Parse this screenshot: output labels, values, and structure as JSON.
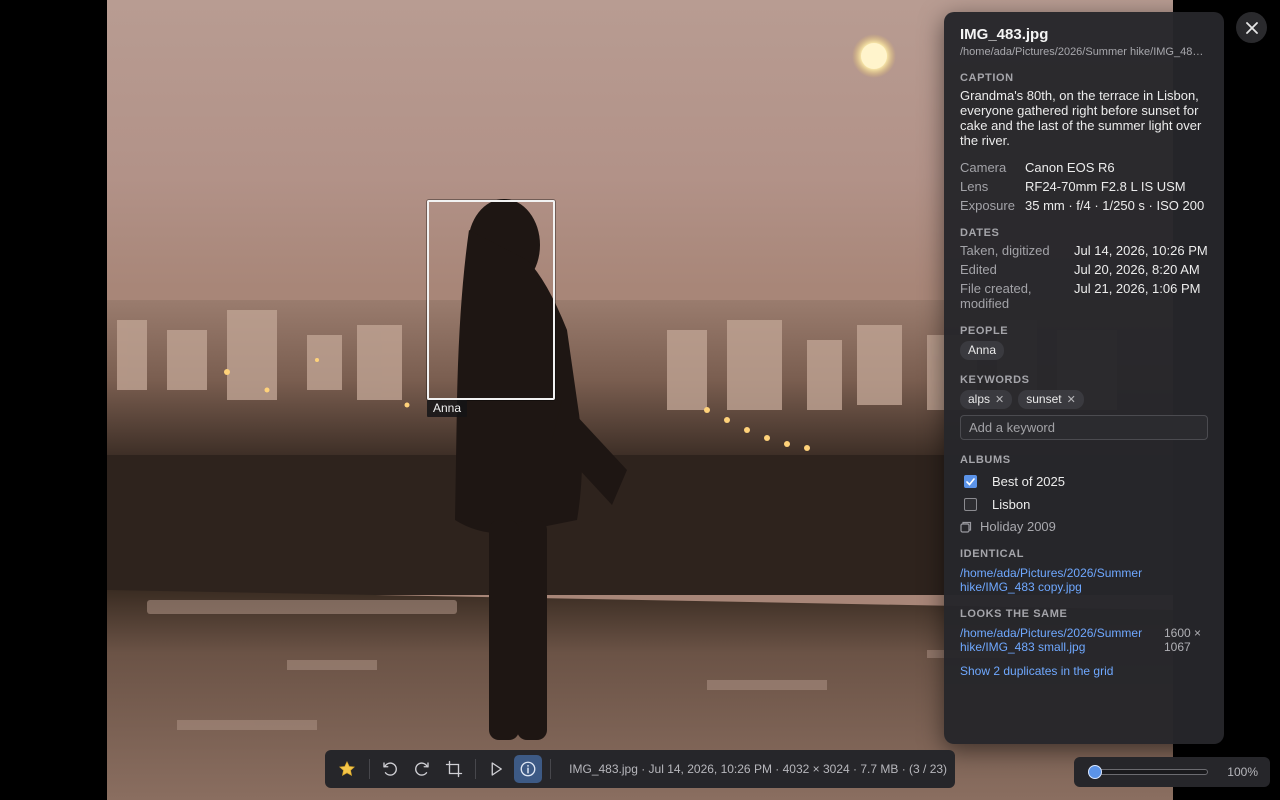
{
  "viewer": {
    "face": {
      "name": "Anna"
    }
  },
  "panel": {
    "file_name": "IMG_483.jpg",
    "file_path": "/home/ada/Pictures/2026/Summer hike/IMG_48…",
    "caption_label": "CAPTION",
    "caption": "Grandma's 80th, on the terrace in Lisbon, everyone gathered right before sunset for cake and the last of the summer light over the river.",
    "meta": [
      {
        "key": "Camera",
        "value": "Canon EOS R6",
        "link": true
      },
      {
        "key": "Lens",
        "value": "RF24-70mm F2.8 L IS USM",
        "link": true
      },
      {
        "key": "Exposure",
        "value": "35 mm · f/4 · 1/250 s · ISO 200",
        "link": false
      }
    ],
    "dates_label": "DATES",
    "dates": [
      {
        "key": "Taken, digitized",
        "value": "Jul 14, 2026, 10:26 PM"
      },
      {
        "key": "Edited",
        "value": "Jul 20, 2026, 8:20 AM"
      },
      {
        "key": "File created, modified",
        "value": "Jul 21, 2026, 1:06 PM"
      }
    ],
    "people_label": "PEOPLE",
    "people": [
      "Anna"
    ],
    "keywords_label": "KEYWORDS",
    "keywords": [
      "alps",
      "sunset"
    ],
    "keyword_placeholder": "Add a keyword",
    "albums_label": "ALBUMS",
    "albums": [
      {
        "name": "Best of 2025",
        "checked": true
      },
      {
        "name": "Lisbon",
        "checked": false
      }
    ],
    "smart_album": "Holiday 2009",
    "identical_label": "IDENTICAL",
    "identical_path": "/home/ada/Pictures/2026/Summer hike/IMG_483 copy.jpg",
    "similar_label": "LOOKS THE SAME",
    "similar_path": "/home/ada/Pictures/2026/Summer hike/IMG_483 small.jpg",
    "similar_size": "1600 × 1067",
    "show_duplicates": "Show 2 duplicates in the grid"
  },
  "toolbar": {
    "info": "IMG_483.jpg · Jul 14, 2026, 10:26 PM · 4032 × 3024 · 7.7 MB · (3 / 23)"
  },
  "zoom": {
    "value": "100%",
    "level": 0
  },
  "colors": {
    "accent": "#5b93e8",
    "link": "#6fa8ff",
    "panel_bg": "#26262a"
  }
}
